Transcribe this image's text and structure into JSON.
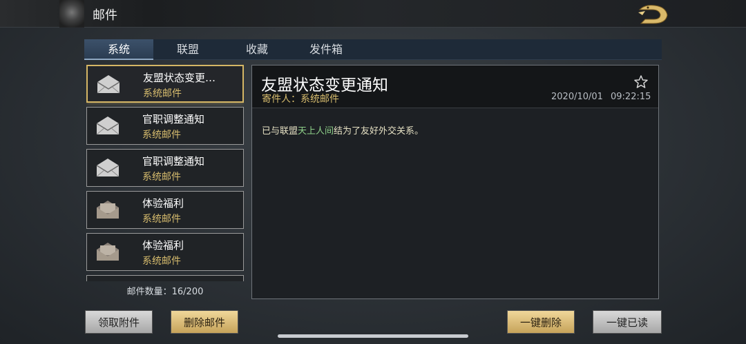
{
  "header": {
    "title": "邮件"
  },
  "tabs": [
    {
      "label": "系统",
      "active": true
    },
    {
      "label": "联盟",
      "active": false
    },
    {
      "label": "收藏",
      "active": false
    },
    {
      "label": "发件箱",
      "active": false
    }
  ],
  "mail_list": {
    "items": [
      {
        "title": "友盟状态变更…",
        "subtitle": "系统邮件",
        "icon": "envelope-icon",
        "selected": true
      },
      {
        "title": "官职调整通知",
        "subtitle": "系统邮件",
        "icon": "envelope-icon",
        "selected": false
      },
      {
        "title": "官职调整通知",
        "subtitle": "系统邮件",
        "icon": "envelope-icon",
        "selected": false
      },
      {
        "title": "体验福利",
        "subtitle": "系统邮件",
        "icon": "envelope-open-icon",
        "selected": false
      },
      {
        "title": "体验福利",
        "subtitle": "系统邮件",
        "icon": "envelope-open-icon",
        "selected": false
      }
    ],
    "count_label": "邮件数量：16/200"
  },
  "detail": {
    "title": "友盟状态变更通知",
    "sender": "寄件人：系统邮件",
    "date": "2020/10/01",
    "time": "09:22:15",
    "body_prefix": "已与联盟",
    "body_highlight": "天上人间",
    "body_suffix": "结为了友好外交关系。"
  },
  "buttons": {
    "claim": "领取附件",
    "delete": "删除邮件",
    "delete_all": "一键删除",
    "read_all": "一键已读"
  },
  "colors": {
    "gold_accent": "#d6b765",
    "highlight_green": "#8fd18a",
    "tab_active": "#3c516a"
  }
}
